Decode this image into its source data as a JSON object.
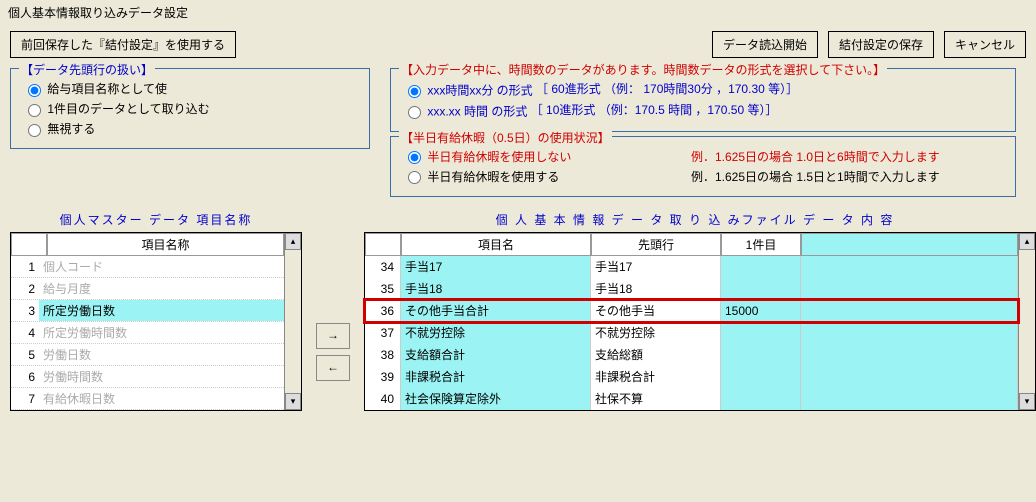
{
  "window_title": "個人基本情報取り込みデータ設定",
  "buttons": {
    "use_prev": "前回保存した『結付設定』を使用する",
    "start_read": "データ読込開始",
    "save_settings": "結付設定の保存",
    "cancel": "キャンセル"
  },
  "fieldset_data_head": {
    "legend": "【データ先頭行の扱い】",
    "opt1": "給与項目名称として使",
    "opt2": "1件目のデータとして取り込む",
    "opt3": "無視する"
  },
  "fieldset_time": {
    "legend": "【入力データ中に、時間数のデータがあります。時間数データの形式を選択して下さい。】",
    "opt1_a": "xxx時間xx分 の形式",
    "opt1_b": "［ 60進形式 （例： 170時間30分 ，170.30  等）］",
    "opt2_a": "xxx.xx 時間 の形式",
    "opt2_b": "［ 10進形式 （例：170.5 時間  ，170.50  等）］"
  },
  "fieldset_half": {
    "legend": "【半日有給休暇（0.5日）の使用状況】",
    "opt1": "半日有給休暇を使用しない",
    "opt1_ex": "例．1.625日の場合   1.0日と6時間で入力します",
    "opt2": "半日有給休暇を使用する",
    "opt2_ex": "例．1.625日の場合   1.5日と1時間で入力します"
  },
  "left_header": "個人マスター  データ  項目名称",
  "left_col_head": "項目名称",
  "left_rows": [
    {
      "n": "1",
      "label": "個人コード",
      "dim": true
    },
    {
      "n": "2",
      "label": "給与月度",
      "dim": true
    },
    {
      "n": "3",
      "label": "所定労働日数",
      "hl": true
    },
    {
      "n": "4",
      "label": "所定労働時間数",
      "dim": true
    },
    {
      "n": "5",
      "label": "労働日数",
      "dim": true
    },
    {
      "n": "6",
      "label": "労働時間数",
      "dim": true
    },
    {
      "n": "7",
      "label": "有給休暇日数",
      "dim": true
    }
  ],
  "arrow_right": "→",
  "arrow_left": "←",
  "right_header": "個  人  基  本  情  報    デ ー タ   取 り 込 みファイル    デ ー タ  内 容",
  "big_head": {
    "name": "項目名",
    "ahead": "先頭行",
    "first": "1件目"
  },
  "big_rows": [
    {
      "n": "34",
      "name": "手当17",
      "ahead": "手当17",
      "first": ""
    },
    {
      "n": "35",
      "name": "手当18",
      "ahead": "手当18",
      "first": ""
    },
    {
      "n": "36",
      "name": "その他手当合計",
      "ahead": "その他手当",
      "first": "15000",
      "highlight": true
    },
    {
      "n": "37",
      "name": "不就労控除",
      "ahead": "不就労控除",
      "first": ""
    },
    {
      "n": "38",
      "name": "支給額合計",
      "ahead": "支給総額",
      "first": ""
    },
    {
      "n": "39",
      "name": "非課税合計",
      "ahead": "非課税合計",
      "first": ""
    },
    {
      "n": "40",
      "name": "社会保険算定除外",
      "ahead": "社保不算",
      "first": ""
    }
  ]
}
